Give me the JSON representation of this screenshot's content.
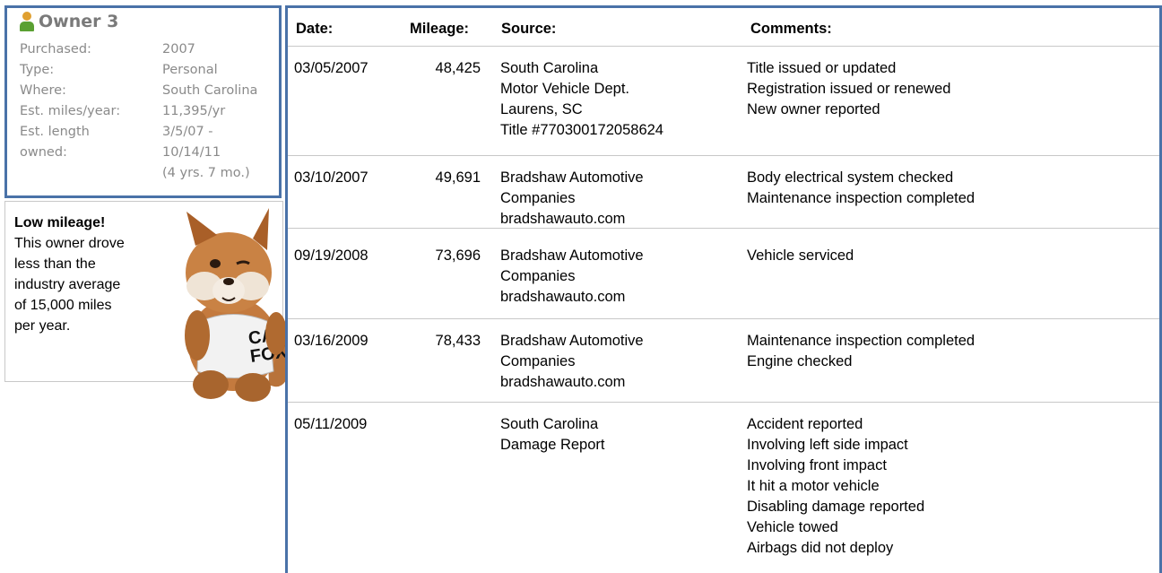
{
  "owner": {
    "title": "Owner 3",
    "details": [
      {
        "label": "Purchased:",
        "value": [
          "2007"
        ]
      },
      {
        "label": "Type:",
        "value": [
          "Personal"
        ]
      },
      {
        "label": "Where:",
        "value": [
          "South Carolina"
        ]
      },
      {
        "label": "Est. miles/year:",
        "value": [
          "11,395/yr"
        ]
      },
      {
        "label": "Est. length owned:",
        "value": [
          "3/5/07 -",
          "10/14/11",
          "(4 yrs. 7 mo.)"
        ]
      }
    ]
  },
  "low_mileage": {
    "title": "Low mileage!",
    "lines": [
      "This owner drove",
      "less than the",
      "industry average",
      "of 15,000 miles",
      "per year."
    ]
  },
  "mascot": {
    "shirt_text_line1": "CAR",
    "shirt_text_line2": "FOX"
  },
  "history": {
    "headers": {
      "date": "Date:",
      "mileage": "Mileage:",
      "source": "Source:",
      "comments": "Comments:"
    },
    "rows": [
      {
        "date": "03/05/2007",
        "mileage": "48,425",
        "source": [
          "South Carolina",
          "Motor Vehicle Dept.",
          "Laurens, SC",
          "Title #770300172058624"
        ],
        "comments": [
          "Title issued or updated",
          "Registration issued or renewed",
          "New owner reported"
        ]
      },
      {
        "date": "03/10/2007",
        "mileage": "49,691",
        "source": [
          "Bradshaw Automotive",
          "Companies",
          "bradshawauto.com"
        ],
        "comments": [
          "Body electrical system checked",
          "Maintenance inspection completed"
        ]
      },
      {
        "date": "09/19/2008",
        "mileage": "73,696",
        "source": [
          "Bradshaw Automotive",
          "Companies",
          "bradshawauto.com"
        ],
        "comments": [
          "Vehicle serviced"
        ]
      },
      {
        "date": "03/16/2009",
        "mileage": "78,433",
        "source": [
          "Bradshaw Automotive",
          "Companies",
          "bradshawauto.com"
        ],
        "comments": [
          "Maintenance inspection completed",
          "Engine checked"
        ]
      },
      {
        "date": "05/11/2009",
        "mileage": "",
        "source": [
          "South Carolina",
          "Damage Report"
        ],
        "comments": [
          "Accident reported",
          "Involving left side impact",
          "Involving front impact",
          "It hit a motor vehicle",
          "Disabling damage reported",
          "Vehicle towed",
          "Airbags did not deploy"
        ]
      }
    ]
  },
  "colors": {
    "panel_border": "#4a72a8",
    "owner_icon_head": "#e0a030",
    "owner_icon_body": "#5aa032",
    "muted_text": "#8a8a8a"
  }
}
